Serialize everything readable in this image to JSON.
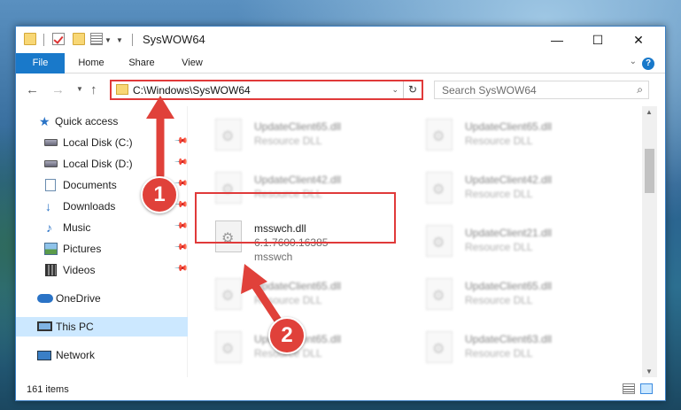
{
  "window": {
    "title": "SysWOW64",
    "controls": {
      "minimize": "—",
      "maximize": "☐",
      "close": "✕"
    }
  },
  "ribbon": {
    "tabs": [
      "File",
      "Home",
      "Share",
      "View"
    ],
    "help": "?"
  },
  "address_bar": {
    "path": "C:\\Windows\\SysWOW64",
    "search_placeholder": "Search SysWOW64"
  },
  "sidebar": {
    "items": [
      {
        "label": "Quick access",
        "icon": "star-icon",
        "pinned": false
      },
      {
        "label": "Local Disk (C:)",
        "icon": "drive-icon",
        "pinned": true
      },
      {
        "label": "Local Disk (D:)",
        "icon": "drive-icon",
        "pinned": true
      },
      {
        "label": "Documents",
        "icon": "documents-icon",
        "pinned": true
      },
      {
        "label": "Downloads",
        "icon": "downloads-icon",
        "pinned": true
      },
      {
        "label": "Music",
        "icon": "music-icon",
        "pinned": true
      },
      {
        "label": "Pictures",
        "icon": "pictures-icon",
        "pinned": true
      },
      {
        "label": "Videos",
        "icon": "videos-icon",
        "pinned": true
      },
      {
        "label": "OneDrive",
        "icon": "onedrive-icon",
        "pinned": false
      },
      {
        "label": "This PC",
        "icon": "this-pc-icon",
        "pinned": false,
        "selected": true
      },
      {
        "label": "Network",
        "icon": "network-icon",
        "pinned": false
      }
    ]
  },
  "files": {
    "left_column": [
      {
        "name": "UpdateClient65.dll",
        "type": "Resource DLL"
      },
      {
        "name": "UpdateClient42.dll",
        "type": "Resource DLL"
      },
      {
        "name": "msswch.dll",
        "version": "6.1.7600.16385",
        "description": "msswch",
        "highlighted": true
      },
      {
        "name": "UpdateClient65.dll",
        "type": "Resource DLL"
      },
      {
        "name": "UpdateClient65.dll",
        "type": "Resource DLL"
      }
    ],
    "right_column": [
      {
        "name": "UpdateClient65.dll",
        "type": "Resource DLL"
      },
      {
        "name": "UpdateClient42.dll",
        "type": "Resource DLL"
      },
      {
        "name": "UpdateClient21.dll",
        "type": "Resource DLL"
      },
      {
        "name": "UpdateClient65.dll",
        "type": "Resource DLL"
      },
      {
        "name": "UpdateClient63.dll",
        "type": "Resource DLL"
      }
    ]
  },
  "status": {
    "item_count": "161 items"
  },
  "annotations": {
    "step1": "1",
    "step2": "2",
    "accent": "#e0413a"
  }
}
